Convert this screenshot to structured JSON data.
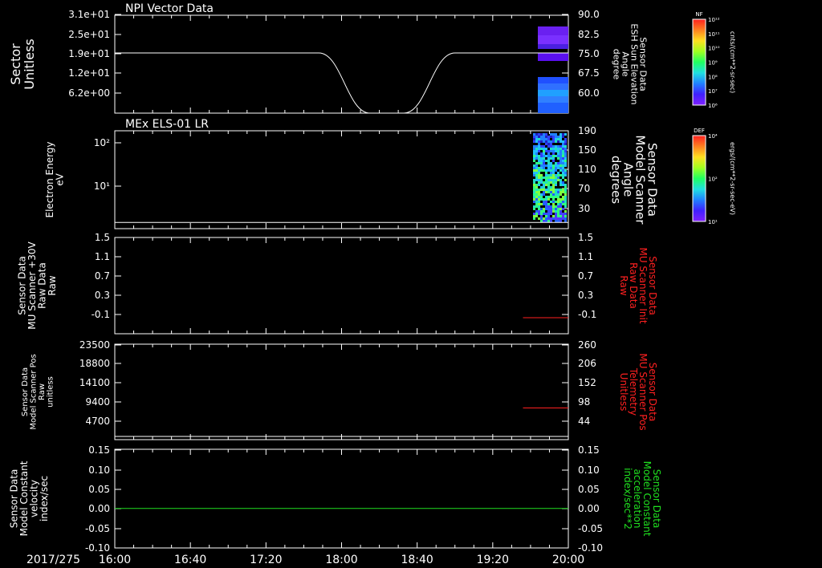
{
  "date_label": "2017/275",
  "time_ticks": [
    "16:00",
    "16:40",
    "17:20",
    "18:00",
    "18:40",
    "19:20",
    "20:00"
  ],
  "colors": {
    "white": "#ffffff",
    "red": "#ff2020",
    "green": "#20e020",
    "bg": "#000000"
  },
  "chart_data": [
    {
      "type": "heatmap",
      "title": "NPI Vector Data",
      "ylabel": [
        "Sector",
        "Unitless"
      ],
      "y_ticks": [
        "3.1e+01",
        "2.5e+01",
        "1.9e+01",
        "1.2e+01",
        "6.2e+00"
      ],
      "right_ticks": [
        "90.0",
        "82.5",
        "75.0",
        "67.5",
        "60.0"
      ],
      "right_label": [
        "Sensor Data",
        "ESH Sun Elevation",
        "Angle",
        "degree"
      ],
      "ylim_right": [
        55,
        90
      ],
      "line": {
        "t": [
          16.0,
          17.8,
          18.0,
          18.15,
          18.3,
          18.45,
          18.6,
          18.75,
          18.95,
          20.0
        ],
        "v": [
          76.5,
          76.5,
          72,
          62,
          55,
          55,
          62,
          72,
          76.5,
          76.5
        ]
      },
      "colorbar": {
        "label": "NF",
        "unit": "cnts/(cm**2-sr-sec)",
        "ticks": [
          "10¹²",
          "10¹¹",
          "10¹⁰",
          "10⁹",
          "10⁸",
          "10⁷",
          "10⁶"
        ]
      }
    },
    {
      "type": "heatmap",
      "title": "MEx ELS-01 LR",
      "ylabel": [
        "Electron Energy",
        "eV"
      ],
      "y_ticks": [
        "10²",
        "10¹"
      ],
      "right_ticks": [
        "190",
        "150",
        "110",
        "70",
        "30"
      ],
      "right_label": [
        "Sensor Data",
        "Model Scanner",
        "Angle",
        "degrees"
      ],
      "ylim_right": [
        0,
        190
      ],
      "line": {
        "t": [
          16.0,
          20.0
        ],
        "v": [
          12,
          12
        ]
      },
      "colorbar": {
        "label": "DEF",
        "unit": "ergs/(cm**2-sr-sec-eV)",
        "ticks": [
          "10⁴",
          "10²",
          "10¹"
        ]
      }
    },
    {
      "type": "line",
      "ylabel": [
        "Sensor Data",
        "MU Scanner +30V",
        "Raw Data",
        "Raw"
      ],
      "y_ticks": [
        "1.5",
        "1.1",
        "0.7",
        "0.3",
        "-0.1"
      ],
      "right_ticks": [
        "1.5",
        "1.1",
        "0.7",
        "0.3",
        "-0.1"
      ],
      "right_label": [
        "Sensor Data",
        "MU Scanner Init",
        "Raw Data",
        "Raw"
      ],
      "ylim": [
        -0.3,
        1.5
      ],
      "series": [
        {
          "t": [
            19.6,
            20.0
          ],
          "v": [
            0.0,
            0.0
          ]
        }
      ]
    },
    {
      "type": "line",
      "ylabel": [
        "Sensor Data",
        "Model Scanner Pos",
        "Raw",
        "unitless"
      ],
      "y_ticks": [
        "23500",
        "18800",
        "14100",
        "9400",
        "4700"
      ],
      "right_ticks": [
        "260",
        "206",
        "152",
        "98",
        "44"
      ],
      "right_label": [
        "Sensor Data",
        "MU Scanner Pos",
        "Telemetry",
        "Unitless"
      ],
      "ylim": [
        0,
        23500
      ],
      "series": [
        {
          "t": [
            19.6,
            20.0
          ],
          "v": [
            7800,
            7800
          ]
        }
      ]
    },
    {
      "type": "line",
      "ylabel": [
        "Sensor Data",
        "Model Constant",
        "velocity",
        "index/sec"
      ],
      "y_ticks": [
        "0.15",
        "0.10",
        "0.05",
        "0.00",
        "-0.05",
        "-0.10"
      ],
      "right_ticks": [
        "0.15",
        "0.10",
        "0.05",
        "0.00",
        "-0.05",
        "-0.10"
      ],
      "right_label": [
        "Sensor Data",
        "Model Constant",
        "acceleration",
        "index/sec**2"
      ],
      "ylim": [
        -0.1,
        0.15
      ],
      "series": [
        {
          "t": [
            16.0,
            20.0
          ],
          "v": [
            0.0,
            0.0
          ]
        }
      ]
    }
  ]
}
